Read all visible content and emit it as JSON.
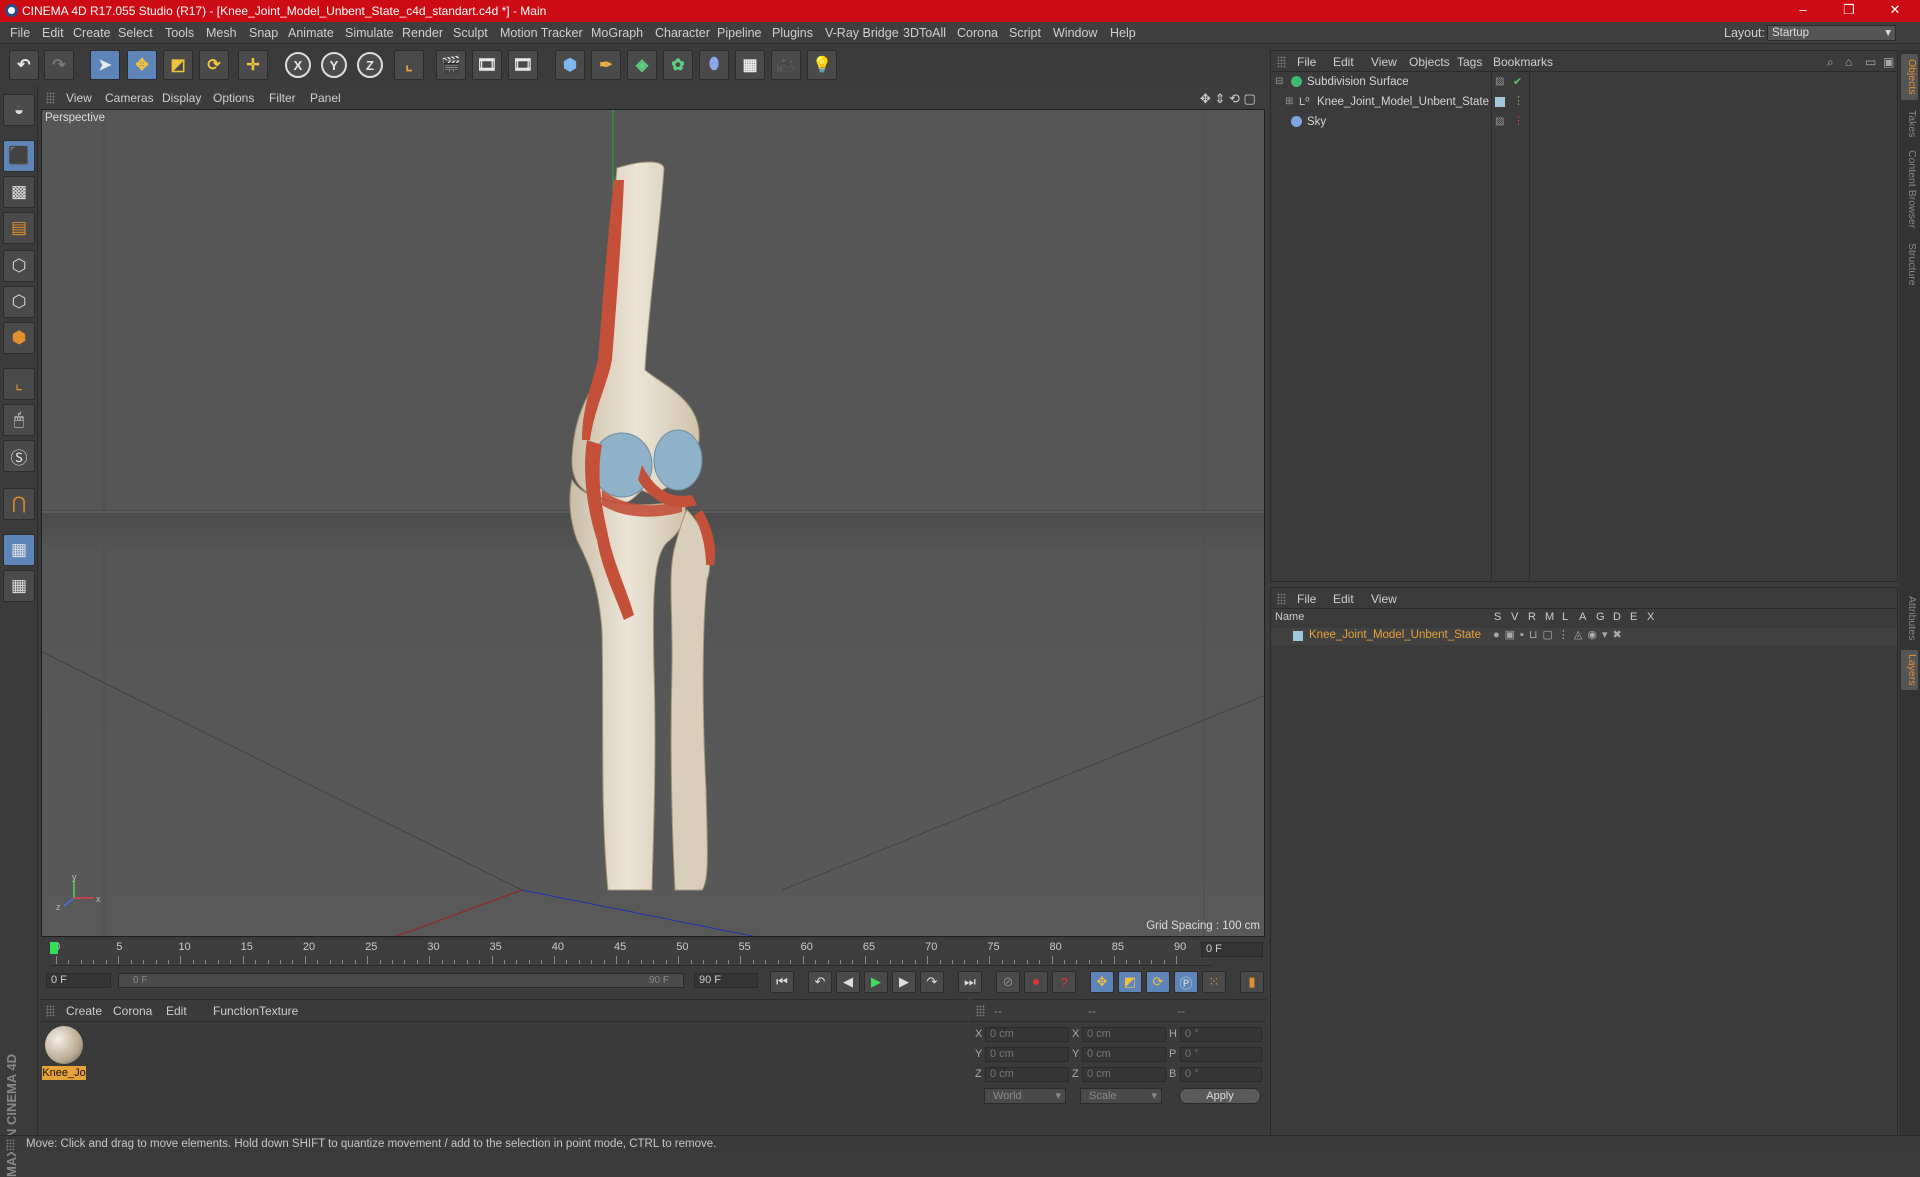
{
  "window": {
    "title": "CINEMA 4D R17.055 Studio (R17) - [Knee_Joint_Model_Unbent_State_c4d_standart.c4d *] - Main",
    "controls": [
      "–",
      "❐",
      "✕"
    ]
  },
  "menubar": {
    "items": [
      "File",
      "Edit",
      "Create",
      "Select",
      "Tools",
      "Mesh",
      "Snap",
      "Animate",
      "Simulate",
      "Render",
      "Sculpt",
      "Motion Tracker",
      "MoGraph",
      "Character",
      "Pipeline",
      "Plugins",
      "V-Ray Bridge",
      "3DToAll",
      "Corona",
      "Script",
      "Window",
      "Help"
    ],
    "layout_label": "Layout:",
    "layout_value": "Startup"
  },
  "toolbar": {
    "axis_x": "X",
    "axis_y": "Y",
    "axis_z": "Z"
  },
  "viewport": {
    "menu": [
      "View",
      "Cameras",
      "Display",
      "Options",
      "Filter",
      "Panel"
    ],
    "camera_label": "Perspective",
    "grid_spacing": "Grid Spacing : 100 cm",
    "axis_y": "y",
    "axis_x": "x",
    "axis_z": "z"
  },
  "timeline": {
    "ticks": [
      "0",
      "5",
      "10",
      "15",
      "20",
      "25",
      "30",
      "35",
      "40",
      "45",
      "50",
      "55",
      "60",
      "65",
      "70",
      "75",
      "80",
      "85",
      "90"
    ],
    "current_frame": "0 F",
    "start_field": "0 F",
    "slider_start": "0 F",
    "slider_end": "90 F",
    "end_field": "90 F"
  },
  "material_manager": {
    "menu": [
      "Create",
      "Corona",
      "Edit",
      "Function",
      "Texture"
    ],
    "materials": [
      {
        "name": "Knee_Jo"
      }
    ]
  },
  "coordinates": {
    "header": [
      "--",
      "--",
      "--"
    ],
    "rows": [
      {
        "a": "X",
        "av": "0 cm",
        "b": "X",
        "bv": "0 cm",
        "c": "H",
        "cv": "0 °"
      },
      {
        "a": "Y",
        "av": "0 cm",
        "b": "Y",
        "bv": "0 cm",
        "c": "P",
        "cv": "0 °"
      },
      {
        "a": "Z",
        "av": "0 cm",
        "b": "Z",
        "bv": "0 cm",
        "c": "B",
        "cv": "0 °"
      }
    ],
    "mode1": "World",
    "mode2": "Scale",
    "apply": "Apply"
  },
  "object_manager": {
    "menu": [
      "File",
      "Edit",
      "View",
      "Objects",
      "Tags",
      "Bookmarks"
    ],
    "objects": [
      {
        "name": "Subdivision Surface"
      },
      {
        "name": "Knee_Joint_Model_Unbent_State"
      },
      {
        "name": "Sky"
      }
    ]
  },
  "layer_manager": {
    "menu": [
      "File",
      "Edit",
      "View"
    ],
    "columns": [
      "Name",
      "S",
      "V",
      "R",
      "M",
      "L",
      "A",
      "G",
      "D",
      "E",
      "X"
    ],
    "layers": [
      {
        "name": "Knee_Joint_Model_Unbent_State",
        "color": "#9fc7d8"
      }
    ]
  },
  "right_tabs": [
    "Objects",
    "Takes",
    "Content Browser",
    "Structure",
    "Attributes",
    "Layers"
  ],
  "branding": "MAXON CINEMA 4D",
  "status": "Move: Click and drag to move elements. Hold down SHIFT to quantize movement / add to the selection in point mode, CTRL to remove.",
  "colors": {
    "titlebar": "#cc0b14",
    "selected_tool": "#5e85b9",
    "layer_name": "#e8a23a"
  }
}
